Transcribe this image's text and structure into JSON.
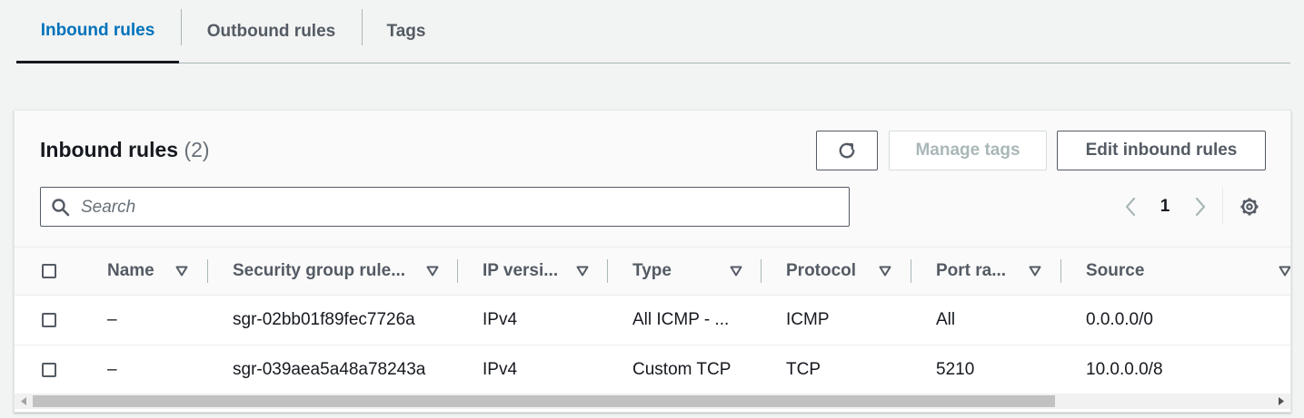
{
  "tabs": [
    {
      "label": "Inbound rules",
      "active": true
    },
    {
      "label": "Outbound rules",
      "active": false
    },
    {
      "label": "Tags",
      "active": false
    }
  ],
  "panel": {
    "title": "Inbound rules",
    "count": "(2)",
    "buttons": {
      "refresh_icon": "refresh-icon",
      "manage_tags": "Manage tags",
      "edit_inbound_rules": "Edit inbound rules"
    },
    "search": {
      "placeholder": "Search",
      "value": ""
    },
    "pagination": {
      "current_page": "1"
    }
  },
  "table": {
    "columns": [
      "Name",
      "Security group rule...",
      "IP versi...",
      "Type",
      "Protocol",
      "Port ra...",
      "Source"
    ],
    "rows": [
      {
        "name": "–",
        "rule_id": "sgr-02bb01f89fec7726a",
        "ip_version": "IPv4",
        "type": "All ICMP - ...",
        "protocol": "ICMP",
        "port_range": "All",
        "source": "0.0.0.0/0"
      },
      {
        "name": "–",
        "rule_id": "sgr-039aea5a48a78243a",
        "ip_version": "IPv4",
        "type": "Custom TCP",
        "protocol": "TCP",
        "port_range": "5210",
        "source": "10.0.0.0/8"
      }
    ]
  },
  "colors": {
    "accent": "#0073bb",
    "text": "#16191f",
    "muted": "#545b64",
    "disabled": "#aab7b8",
    "background": "#f2f3f3"
  }
}
